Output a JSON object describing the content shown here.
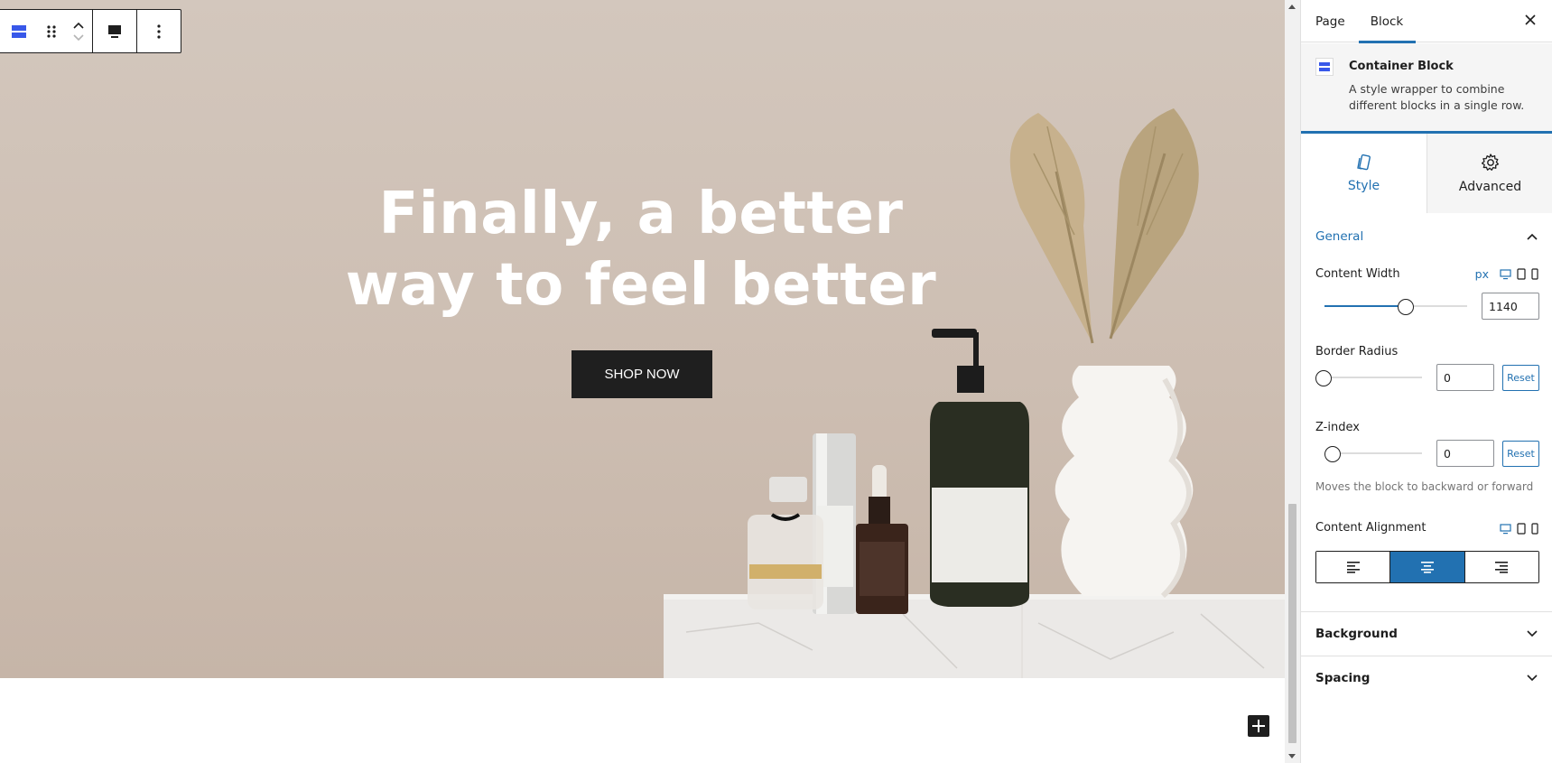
{
  "hero": {
    "title_line1": "Finally, a better",
    "title_line2": "way to feel better",
    "button_label": "SHOP NOW"
  },
  "sidebar": {
    "tabs": [
      {
        "label": "Page"
      },
      {
        "label": "Block",
        "active": true
      }
    ],
    "block": {
      "name": "Container Block",
      "description": "A style wrapper to combine different blocks in a single row."
    },
    "style_tabs": [
      {
        "label": "Style",
        "icon": "brush-icon",
        "active": true
      },
      {
        "label": "Advanced",
        "icon": "gear-icon"
      }
    ],
    "general": {
      "title": "General",
      "content_width": {
        "label": "Content Width",
        "unit": "px",
        "value": "1140",
        "slider_fraction": 0.57
      },
      "border_radius": {
        "label": "Border Radius",
        "value": "0",
        "reset_label": "Reset",
        "slider_fraction": 0
      },
      "z_index": {
        "label": "Z-index",
        "value": "0",
        "reset_label": "Reset",
        "help": "Moves the block to backward or forward",
        "slider_fraction": 0
      },
      "content_alignment": {
        "label": "Content Alignment",
        "options": [
          "left",
          "center",
          "right"
        ],
        "selected": "center"
      }
    },
    "sections": [
      {
        "title": "Background"
      },
      {
        "title": "Spacing"
      }
    ]
  },
  "colors": {
    "accent": "#2271b1",
    "hero_bg": "#cdbeb2",
    "button_bg": "#1f1f1f"
  }
}
